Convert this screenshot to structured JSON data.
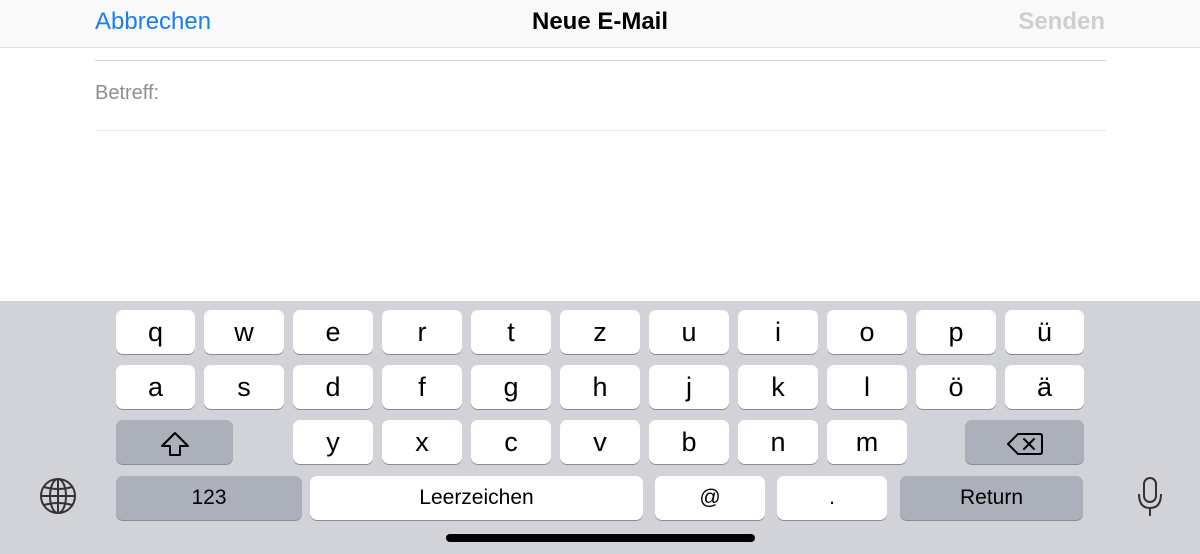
{
  "navbar": {
    "cancel_label": "Abbrechen",
    "title": "Neue E-Mail",
    "send_label": "Senden"
  },
  "compose": {
    "subject_label": "Betreff:",
    "subject_value": "",
    "body_value": ""
  },
  "keyboard": {
    "row1": [
      "q",
      "w",
      "e",
      "r",
      "t",
      "z",
      "u",
      "i",
      "o",
      "p",
      "ü"
    ],
    "row2": [
      "a",
      "s",
      "d",
      "f",
      "g",
      "h",
      "j",
      "k",
      "l",
      "ö",
      "ä"
    ],
    "row3": [
      "y",
      "x",
      "c",
      "v",
      "b",
      "n",
      "m"
    ],
    "numbers_label": "123",
    "space_label": "Leerzeichen",
    "at_label": "@",
    "dot_label": ".",
    "return_label": "Return",
    "shift_icon": "shift-arrow",
    "backspace_icon": "delete-backward",
    "globe_icon": "globe",
    "mic_icon": "microphone"
  },
  "colors": {
    "accent": "#1a7ff0",
    "keyboard_bg": "#d1d3d9",
    "key_light": "#ffffff",
    "key_dark": "#abb0ba"
  }
}
